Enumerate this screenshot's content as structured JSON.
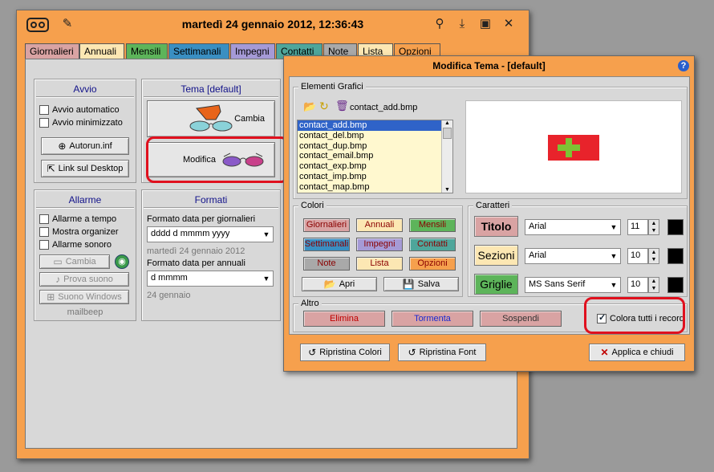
{
  "window": {
    "title": "martedì 24 gennaio 2012,  12:36:43",
    "tabs": [
      {
        "label": "Giornalieri",
        "color": "#d9a3a3"
      },
      {
        "label": "Annuali",
        "color": "#fce7b3"
      },
      {
        "label": "Mensili",
        "color": "#5db45a"
      },
      {
        "label": "Settimanali",
        "color": "#3a8fc2"
      },
      {
        "label": "Impegni",
        "color": "#a59ad6"
      },
      {
        "label": "Contatti",
        "color": "#4ea69b"
      },
      {
        "label": "Note",
        "color": "#a9a9a9"
      },
      {
        "label": "Lista",
        "color": "#fce7b3"
      },
      {
        "label": "Opzioni",
        "color": "#f6a04d"
      }
    ]
  },
  "avvio": {
    "title": "Avvio",
    "auto_start": "Avvio automatico",
    "minimized": "Avvio minimizzato",
    "autorun_button": "Autorun.inf",
    "desktop_link_button": "Link sul Desktop"
  },
  "tema": {
    "title": "Tema [default]",
    "change_button": "Cambia",
    "edit_button": "Modifica"
  },
  "allarme": {
    "title": "Allarme",
    "timed": "Allarme a tempo",
    "show_organizer": "Mostra organizer",
    "sound_alarm": "Allarme sonoro",
    "change_button": "Cambia",
    "test_sound_button": "Prova suono",
    "windows_sound_button": "Suono Windows",
    "sound_name": "mailbeep"
  },
  "formati": {
    "title": "Formati",
    "daily_label": "Formato data per giornalieri",
    "daily_value": "dddd d mmmm yyyy",
    "daily_example": "martedì 24 gennaio 2012",
    "annual_label": "Formato data per annuali",
    "annual_value": "d mmmm",
    "annual_example": "24 gennaio"
  },
  "dialog": {
    "title": "Modifica Tema - [default]",
    "help": "?",
    "elementi_title": "Elementi Grafici",
    "selected_file": "contact_add.bmp",
    "files": [
      "contact_add.bmp",
      "contact_del.bmp",
      "contact_dup.bmp",
      "contact_email.bmp",
      "contact_exp.bmp",
      "contact_imp.bmp",
      "contact_map.bmp"
    ],
    "colori_title": "Colori",
    "color_buttons": [
      {
        "label": "Giornalieri",
        "bg": "#d9a3a3",
        "fg": "#8a0000"
      },
      {
        "label": "Annuali",
        "bg": "#fce7b3",
        "fg": "#8a0000"
      },
      {
        "label": "Mensili",
        "bg": "#5db45a",
        "fg": "#8a0000"
      },
      {
        "label": "Settimanali",
        "bg": "#3a8fc2",
        "fg": "#8a0000"
      },
      {
        "label": "Impegni",
        "bg": "#a59ad6",
        "fg": "#8a0000"
      },
      {
        "label": "Contatti",
        "bg": "#4ea69b",
        "fg": "#8a0000"
      },
      {
        "label": "Note",
        "bg": "#a9a9a9",
        "fg": "#8a0000"
      },
      {
        "label": "Lista",
        "bg": "#fce7b3",
        "fg": "#8a0000"
      },
      {
        "label": "Opzioni",
        "bg": "#f6a04d",
        "fg": "#8a0000"
      }
    ],
    "open_button": "Apri",
    "save_button": "Salva",
    "caratteri_title": "Caratteri",
    "char_rows": [
      {
        "label": "Titolo",
        "bg": "#d9a3a3",
        "font": "Arial",
        "size": "11"
      },
      {
        "label": "Sezioni",
        "bg": "#fce7b3",
        "font": "Arial",
        "size": "10"
      },
      {
        "label": "Griglie",
        "bg": "#5db45a",
        "font": "MS Sans Serif",
        "size": "10"
      }
    ],
    "altro_title": "Altro",
    "altro_buttons": [
      {
        "label": "Elimina",
        "fg": "#c00000",
        "bg": "#d9a3a3"
      },
      {
        "label": "Tormenta",
        "fg": "#1a2ad0",
        "bg": "#d9a3a3"
      },
      {
        "label": "Sospendi",
        "fg": "#333333",
        "bg": "#d9a3a3"
      }
    ],
    "color_all_records": "Colora tutti i record",
    "restore_colors_button": "Ripristina Colori",
    "restore_font_button": "Ripristina Font",
    "apply_close_button": "Applica e chiudi"
  }
}
